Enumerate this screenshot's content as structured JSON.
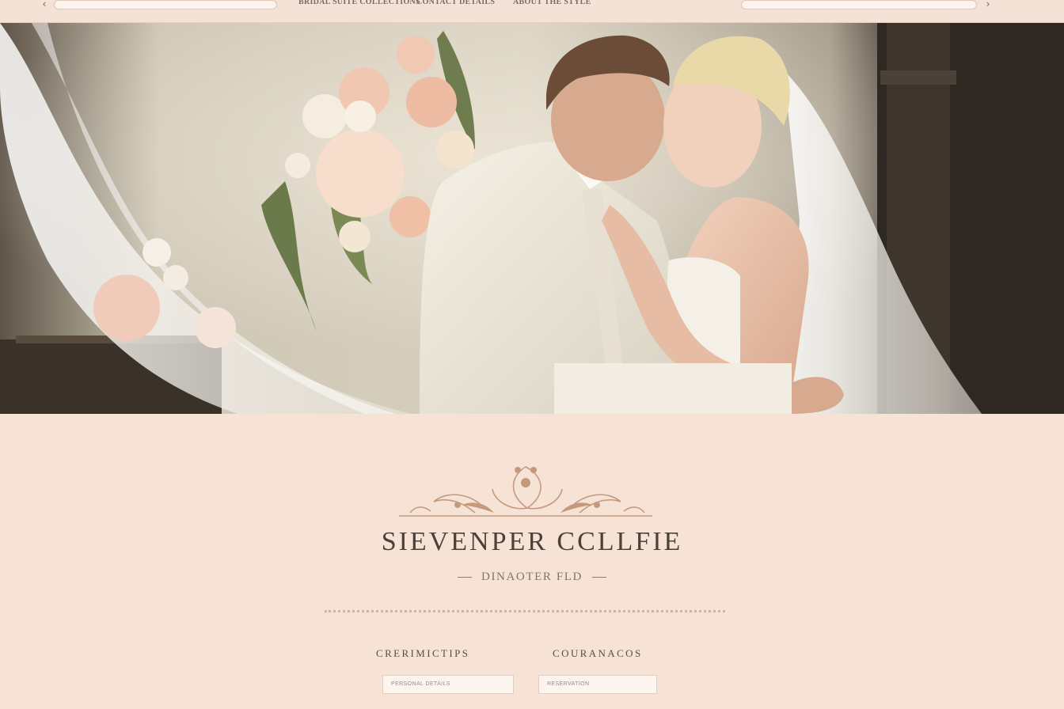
{
  "topbar": {
    "prev_icon": "chevron-left-icon",
    "next_icon": "chevron-right-icon",
    "prev_glyph": "‹",
    "next_glyph": "›",
    "links": [
      "BRIDAL SUITE COLLECTIONS",
      "CONTACT DETAILS",
      "ABOUT THE STYLE"
    ]
  },
  "hero": {
    "alt": "Bride and groom embracing beside a bouquet of peonies and roses"
  },
  "brand": {
    "ornament_icon": "floral-crest-ornament",
    "title": "SIEVENPER CCLLFIE",
    "subtitle": "DINAOTER FLD"
  },
  "columns": [
    {
      "label": "CRERIMICTIPS",
      "field_text": "PERSONAL DETAILS"
    },
    {
      "label": "COURANACOS",
      "field_text": "RESERVATION"
    }
  ],
  "colors": {
    "background": "#f6e3d6",
    "accent": "#c49a7e",
    "text": "#4b413a"
  }
}
